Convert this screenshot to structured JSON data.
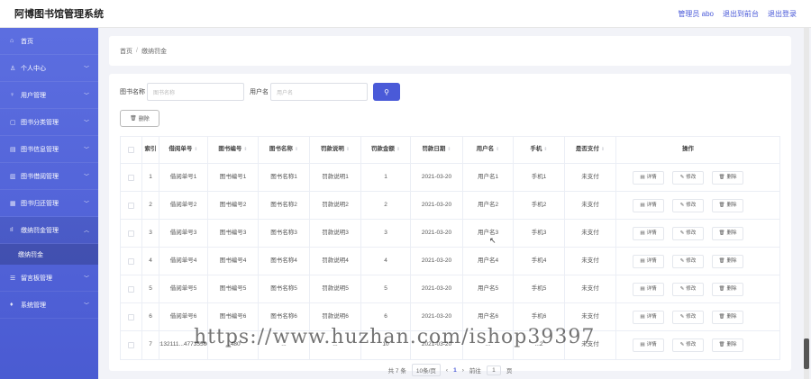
{
  "header": {
    "title": "阿博图书馆管理系统",
    "links": [
      "管理员 abo",
      "退出到前台",
      "退出登录"
    ]
  },
  "sidebar": {
    "items": [
      {
        "label": "首页",
        "icon": "home-icon",
        "glyph": "⌂",
        "has_chevron": false
      },
      {
        "label": "个人中心",
        "icon": "user-icon",
        "glyph": "♙",
        "has_chevron": true
      },
      {
        "label": "用户管理",
        "icon": "user-manage-icon",
        "glyph": "♀",
        "has_chevron": true
      },
      {
        "label": "图书分类管理",
        "icon": "category-icon",
        "glyph": "▢",
        "has_chevron": true
      },
      {
        "label": "图书信息管理",
        "icon": "book-info-icon",
        "glyph": "▤",
        "has_chevron": true
      },
      {
        "label": "图书借阅管理",
        "icon": "borrow-icon",
        "glyph": "▥",
        "has_chevron": true
      },
      {
        "label": "图书归还管理",
        "icon": "return-icon",
        "glyph": "▦",
        "has_chevron": true
      },
      {
        "label": "缴纳罚金管理",
        "icon": "bar-chart-icon",
        "glyph": "ıl",
        "has_chevron": true,
        "open": true
      }
    ],
    "submenu": {
      "label": "缴纳罚金"
    },
    "items_after": [
      {
        "label": "留言板管理",
        "icon": "message-icon",
        "glyph": "☰",
        "has_chevron": true
      },
      {
        "label": "系统管理",
        "icon": "system-icon",
        "glyph": "♦",
        "has_chevron": true
      }
    ]
  },
  "breadcrumb": {
    "home": "首页",
    "current": "缴纳罚金"
  },
  "search": {
    "book_name_label": "图书名称",
    "book_name_placeholder": "图书名称",
    "username_label": "用户名",
    "username_placeholder": "用户名",
    "button_glyph": "⚲"
  },
  "toolbar": {
    "delete_label": "删除"
  },
  "table": {
    "columns": [
      "索引",
      "借阅单号",
      "图书编号",
      "图书名称",
      "罚款说明",
      "罚款金额",
      "罚款日期",
      "用户名",
      "手机",
      "是否支付",
      "操作"
    ],
    "sortable": [
      false,
      true,
      true,
      true,
      true,
      true,
      true,
      true,
      true,
      true,
      false
    ],
    "rows": [
      [
        "1",
        "借阅单号1",
        "图书编号1",
        "图书名称1",
        "罚款说明1",
        "1",
        "2021-03-20",
        "用户名1",
        "手机1",
        "未支付"
      ],
      [
        "2",
        "借阅单号2",
        "图书编号2",
        "图书名称2",
        "罚款说明2",
        "2",
        "2021-03-20",
        "用户名2",
        "手机2",
        "未支付"
      ],
      [
        "3",
        "借阅单号3",
        "图书编号3",
        "图书名称3",
        "罚款说明3",
        "3",
        "2021-03-20",
        "用户名3",
        "手机3",
        "未支付"
      ],
      [
        "4",
        "借阅单号4",
        "图书编号4",
        "图书名称4",
        "罚款说明4",
        "4",
        "2021-03-20",
        "用户名4",
        "手机4",
        "未支付"
      ],
      [
        "5",
        "借阅单号5",
        "图书编号5",
        "图书名称5",
        "罚款说明5",
        "5",
        "2021-03-20",
        "用户名5",
        "手机5",
        "未支付"
      ],
      [
        "6",
        "借阅单号6",
        "图书编号6",
        "图书名称6",
        "罚款说明6",
        "6",
        "2021-03-20",
        "用户名6",
        "手机6",
        "未支付"
      ],
      [
        "7",
        "202132111...4773556007",
        "...480",
        "...",
        "...",
        "10",
        "2021-03-20",
        "...",
        "...2",
        "未支付"
      ]
    ],
    "actions": {
      "detail": "详情",
      "edit": "修改",
      "delete": "删除"
    }
  },
  "pagination": {
    "total": "共 7 条",
    "page_size": "10条/页",
    "prev": "‹",
    "current_page": "1",
    "next": "›",
    "goto_label": "前往",
    "goto_value": "1",
    "page_suffix": "页"
  },
  "watermark": "https://www.huzhan.com/ishop39397"
}
